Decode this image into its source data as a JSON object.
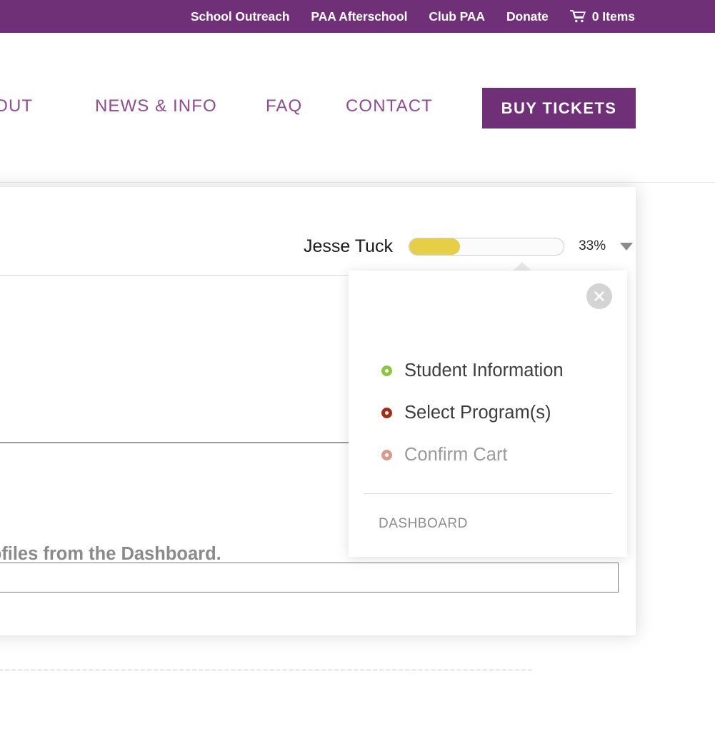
{
  "utility_nav": {
    "items": [
      {
        "label": "School Outreach",
        "name": "utility-nav-school-outreach"
      },
      {
        "label": "PAA Afterschool",
        "name": "utility-nav-paa-afterschool"
      },
      {
        "label": "Club PAA",
        "name": "utility-nav-club-paa"
      },
      {
        "label": "Donate",
        "name": "utility-nav-donate"
      }
    ],
    "cart": {
      "icon": "shopping-cart-icon",
      "label": "0 Items",
      "count": 0
    },
    "background_color": "#6F3078",
    "text_color": "#FFFFFF"
  },
  "main_nav": {
    "items": [
      {
        "label": "ABOUT",
        "name": "main-nav-about"
      },
      {
        "label": "NEWS & INFO",
        "name": "main-nav-news-and-info"
      },
      {
        "label": "FAQ",
        "name": "main-nav-faq"
      },
      {
        "label": "CONTACT",
        "name": "main-nav-contact"
      }
    ],
    "cta": {
      "label": "BUY TICKETS",
      "background_color": "#6F3078",
      "text_color": "#FFFFFF"
    },
    "link_color": "#8E4B93"
  },
  "registration": {
    "student_name": "Jesse Tuck",
    "progress": {
      "percent_label": "33%",
      "percent_value": 33,
      "fill_color": "#E6CE47",
      "track_color": "#FBFBFB"
    },
    "dropdown_toggle_icon": "chevron-down-icon",
    "note_text": "er profiles from the Dashboard."
  },
  "dropdown": {
    "close_icon": "close-circle-icon",
    "steps": [
      {
        "label": "Student Information",
        "state": "done",
        "bullet_color": "#8CC63E"
      },
      {
        "label": "Select Program(s)",
        "state": "current",
        "bullet_color": "#A32E15"
      },
      {
        "label": "Confirm Cart",
        "state": "todo",
        "bullet_color": "#D79A90"
      }
    ],
    "dashboard_label": "DASHBOARD"
  }
}
